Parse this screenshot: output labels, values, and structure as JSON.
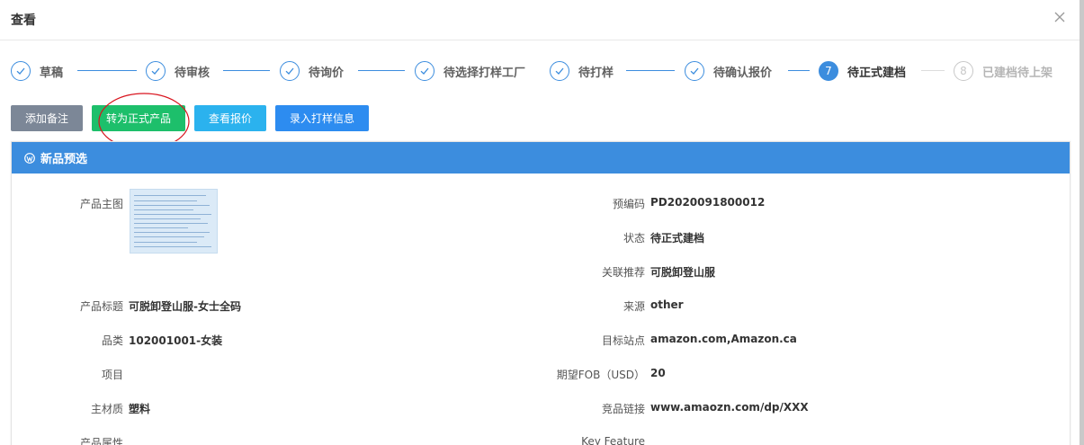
{
  "modal": {
    "title": "查看"
  },
  "steps": [
    {
      "label": "草稿",
      "state": "done",
      "number": ""
    },
    {
      "label": "待审核",
      "state": "done",
      "number": ""
    },
    {
      "label": "待询价",
      "state": "done",
      "number": ""
    },
    {
      "label": "待选择打样工厂",
      "state": "done",
      "number": ""
    },
    {
      "label": "待打样",
      "state": "done",
      "number": ""
    },
    {
      "label": "待确认报价",
      "state": "done",
      "number": ""
    },
    {
      "label": "待正式建档",
      "state": "current",
      "number": "7"
    },
    {
      "label": "已建档待上架",
      "state": "todo",
      "number": "8"
    }
  ],
  "actions": {
    "add_note": "添加备注",
    "convert_product": "转为正式产品",
    "view_quote": "查看报价",
    "enter_sample": "录入打样信息"
  },
  "panel": {
    "title": "新品预选"
  },
  "fields": {
    "main_image_label": "产品主图",
    "precode_label": "预编码",
    "precode_value": "PD2020091800012",
    "status_label": "状态",
    "status_value": "待正式建档",
    "related_label": "关联推荐",
    "related_value": "可脱卸登山服",
    "title_label": "产品标题",
    "title_value": "可脱卸登山服-女士全码",
    "source_label": "来源",
    "source_value": "other",
    "category_label": "品类",
    "category_value": "102001001-女装",
    "site_label": "目标站点",
    "site_value": "amazon.com,Amazon.ca",
    "project_label": "项目",
    "project_value": "",
    "fob_label": "期望FOB（USD）",
    "fob_value": "20",
    "material_label": "主材质",
    "material_value": "塑料",
    "competitor_label": "竞品链接",
    "competitor_value": "www.amaozn.com/dp/XXX",
    "attr_label": "产品属性",
    "feature_label": "Key Feature"
  },
  "colors": {
    "accent": "#3c8dde",
    "add_note": "#7c8797",
    "convert": "#1dbf6b",
    "view_quote": "#2bb2ee",
    "enter_sample": "#2d8cf0",
    "annotation": "#d9141e"
  }
}
